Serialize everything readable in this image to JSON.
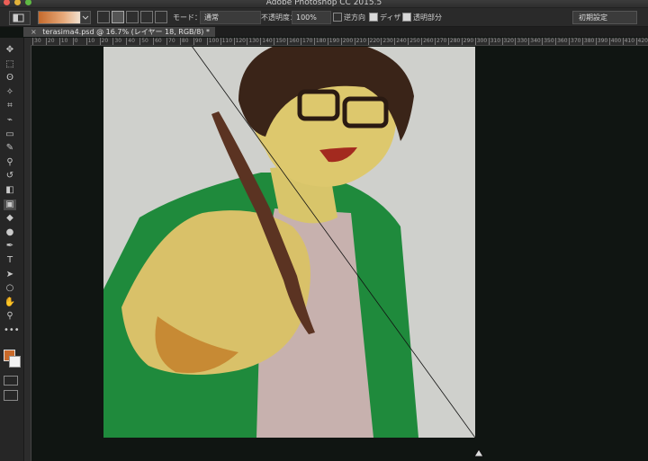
{
  "app": {
    "title": "Adobe Photoshop CC 2015.5",
    "traffic_colors": [
      "#ec5f57",
      "#e1b23a",
      "#5fba44"
    ]
  },
  "options_bar": {
    "mode_label": "モード：",
    "mode_value": "通常",
    "opacity_label": "不透明度：",
    "opacity_value": "100%",
    "reverse_label": "逆方向",
    "reverse_checked": false,
    "dither_label": "ディザ",
    "dither_checked": true,
    "transparency_label": "透明部分",
    "transparency_checked": true,
    "reset_label": "初期設定"
  },
  "document": {
    "tab_label": "terasima4.psd @ 16.7% (レイヤー 18, RGB/8)",
    "modified_mark": "*",
    "close_glyph": "×"
  },
  "ruler": {
    "ticks": [
      "30",
      "20",
      "10",
      "0",
      "10",
      "20",
      "30",
      "40",
      "50",
      "60",
      "70",
      "80",
      "90",
      "100",
      "110",
      "120",
      "130",
      "140",
      "150",
      "160",
      "170",
      "180",
      "190",
      "200",
      "210",
      "220",
      "230",
      "240",
      "250",
      "260",
      "270",
      "280",
      "290",
      "300",
      "310",
      "320",
      "330",
      "340",
      "350",
      "360",
      "370",
      "380",
      "390",
      "400",
      "410",
      "420"
    ]
  },
  "colors": {
    "foreground": "#c96a2a",
    "background": "#f2f2f2",
    "canvas_bg": "#cfd0cc",
    "pasteboard": "#101512"
  },
  "tools": [
    {
      "name": "move-tool-icon",
      "glyph": "✥"
    },
    {
      "name": "marquee-tool-icon",
      "glyph": "⬚"
    },
    {
      "name": "lasso-tool-icon",
      "glyph": "ʘ"
    },
    {
      "name": "magic-wand-tool-icon",
      "glyph": "✧"
    },
    {
      "name": "crop-tool-icon",
      "glyph": "⌗"
    },
    {
      "name": "eyedropper-tool-icon",
      "glyph": "⌁"
    },
    {
      "name": "frame-tool-icon",
      "glyph": "▭"
    },
    {
      "name": "brush-tool-icon",
      "glyph": "✎"
    },
    {
      "name": "stamp-tool-icon",
      "glyph": "⚲"
    },
    {
      "name": "history-brush-tool-icon",
      "glyph": "↺"
    },
    {
      "name": "eraser-tool-icon",
      "glyph": "◧"
    },
    {
      "name": "gradient-tool-icon",
      "glyph": "▣"
    },
    {
      "name": "blur-tool-icon",
      "glyph": "◆"
    },
    {
      "name": "dodge-tool-icon",
      "glyph": "●"
    },
    {
      "name": "pen-tool-icon",
      "glyph": "✒"
    },
    {
      "name": "type-tool-icon",
      "glyph": "T"
    },
    {
      "name": "path-select-tool-icon",
      "glyph": "➤"
    },
    {
      "name": "shape-tool-icon",
      "glyph": "○"
    },
    {
      "name": "hand-tool-icon",
      "glyph": "✋"
    },
    {
      "name": "zoom-tool-icon",
      "glyph": "⚲"
    },
    {
      "name": "more-tools-icon",
      "glyph": "•••"
    }
  ]
}
